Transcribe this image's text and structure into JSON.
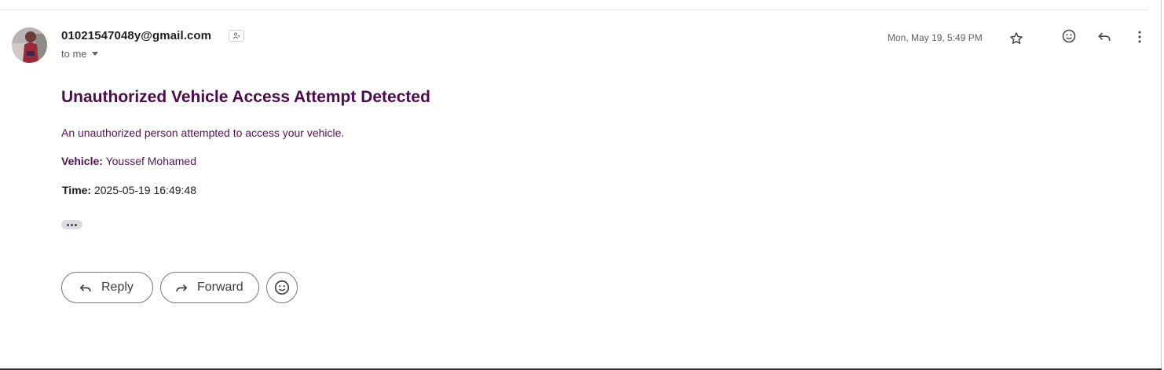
{
  "message": {
    "sender_email": "01021547048y@gmail.com",
    "recipient_label": "to me",
    "date": "Mon, May 19, 5:49 PM"
  },
  "body": {
    "subject": "Unauthorized Vehicle Access Attempt Detected",
    "intro": "An unauthorized person attempted to access your vehicle.",
    "vehicle_label": "Vehicle:",
    "vehicle_value": "Youssef Mohamed",
    "time_label": "Time:",
    "time_value": "2025-05-19 16:49:48"
  },
  "actions": {
    "reply_label": "Reply",
    "forward_label": "Forward"
  },
  "colors": {
    "subject": "#4d0a4d",
    "body_text": "#5a0f5a"
  },
  "icons": {
    "header": [
      "star-icon",
      "emoji-icon",
      "reply-icon",
      "more-vert-icon"
    ],
    "buttons": [
      "reply-icon",
      "forward-icon",
      "emoji-icon"
    ]
  }
}
